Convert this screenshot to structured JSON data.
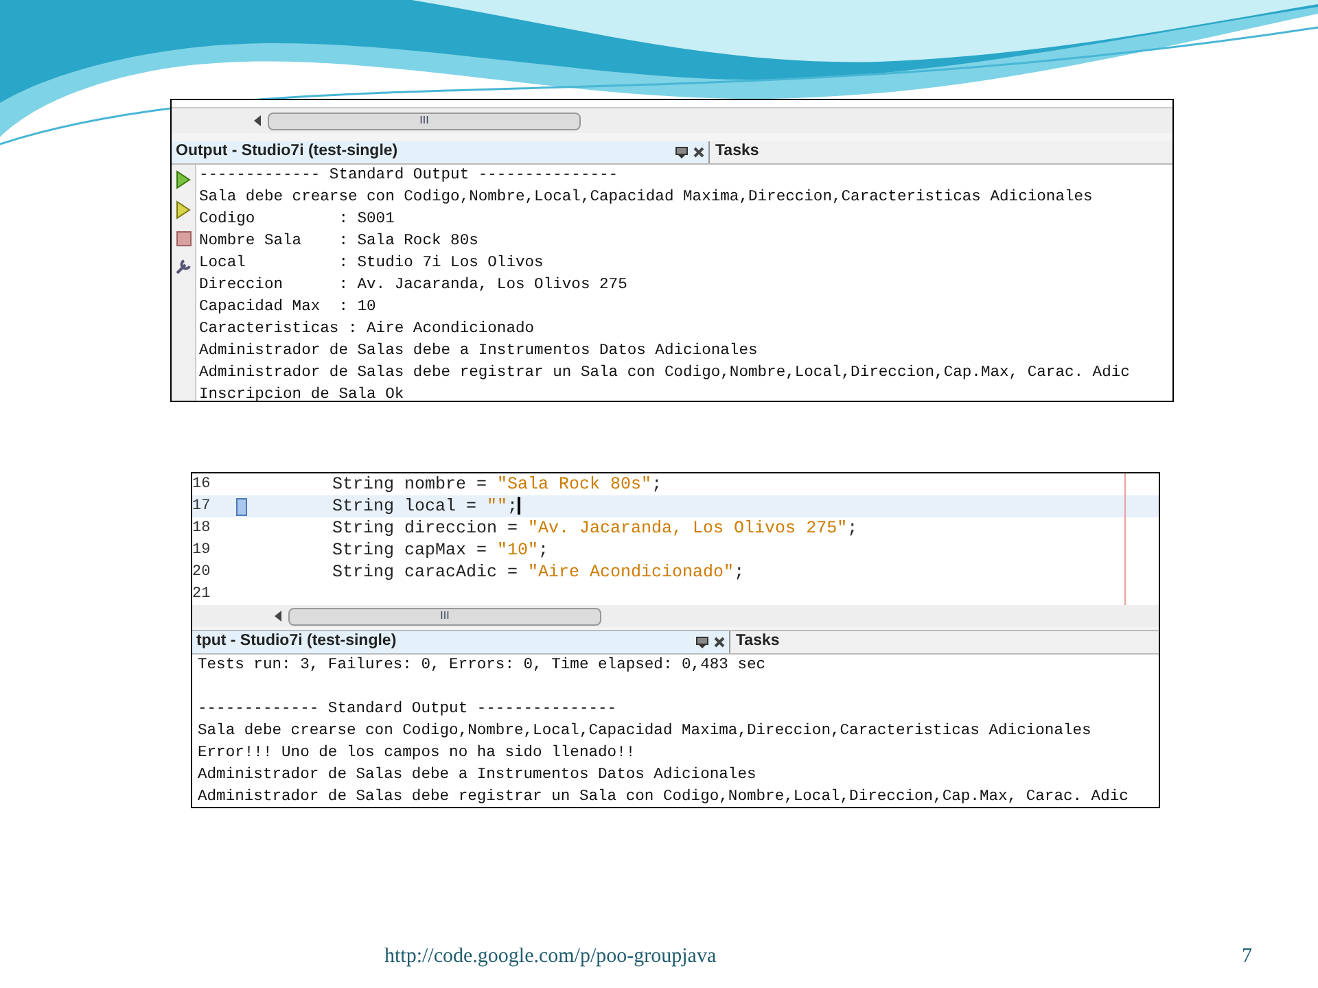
{
  "screenshot_top": {
    "output_tab": {
      "title": "Output - Studio7i (test-single)",
      "selected": true
    },
    "tasks_tab": {
      "title": "Tasks",
      "selected": false
    },
    "scrollbar_grip": "III",
    "lines": [
      "------------- Standard Output ---------------",
      "Sala debe crearse con Codigo,Nombre,Local,Capacidad Maxima,Direccion,Caracteristicas Adicionales",
      "Codigo         : S001",
      "Nombre Sala    : Sala Rock 80s",
      "Local          : Studio 7i Los Olivos",
      "Direccion      : Av. Jacaranda, Los Olivos 275",
      "Capacidad Max  : 10",
      "Caracteristicas : Aire Acondicionado",
      "Administrador de Salas debe a Instrumentos Datos Adicionales",
      "Administrador de Salas debe registrar un Sala con Codigo,Nombre,Local,Direccion,Cap.Max, Carac. Adic",
      "Inscripcion de Sala Ok"
    ]
  },
  "screenshot_bottom": {
    "code_lines": [
      {
        "number": "16",
        "code": "String nombre = ",
        "literal": "\"Sala Rock 80s\"",
        "rest": ";",
        "current": false
      },
      {
        "number": "17",
        "code": "String local = ",
        "literal": "\"\"",
        "rest": ";",
        "current": true
      },
      {
        "number": "18",
        "code": "String direccion = ",
        "literal": "\"Av. Jacaranda, Los Olivos 275\"",
        "rest": ";",
        "current": false
      },
      {
        "number": "19",
        "code": "String capMax = ",
        "literal": "\"10\"",
        "rest": ";",
        "current": false
      },
      {
        "number": "20",
        "code": "String caracAdic = ",
        "literal": "\"Aire Acondicionado\"",
        "rest": ";",
        "current": false
      },
      {
        "number": "21",
        "current": false
      }
    ],
    "scrollbar_grip": "III",
    "output_tab": {
      "title": "tput - Studio7i (test-single)",
      "selected": true
    },
    "tasks_tab": {
      "title": "Tasks",
      "selected": false
    },
    "lines": [
      {
        "kind": "text",
        "text": "Tests run: 3, Failures: 0, Errors: 0, Time elapsed: 0,483 sec"
      },
      {
        "kind": "blank"
      },
      {
        "kind": "text",
        "text": "------------- Standard Output ---------------"
      },
      {
        "kind": "text",
        "text": "Sala debe crearse con Codigo,Nombre,Local,Capacidad Maxima,Direccion,Caracteristicas Adicionales"
      },
      {
        "kind": "text",
        "text": "Error!!! Uno de los campos no ha sido llenado!!"
      },
      {
        "kind": "text",
        "text": "Administrador de Salas debe a Instrumentos Datos Adicionales"
      },
      {
        "kind": "text",
        "text": "Administrador de Salas debe registrar un Sala con Codigo,Nombre,Local,Direccion,Cap.Max, Carac. Adic"
      }
    ]
  },
  "footer": {
    "link": "http://code.google.com/p/poo-groupjava",
    "page_number": "7"
  }
}
